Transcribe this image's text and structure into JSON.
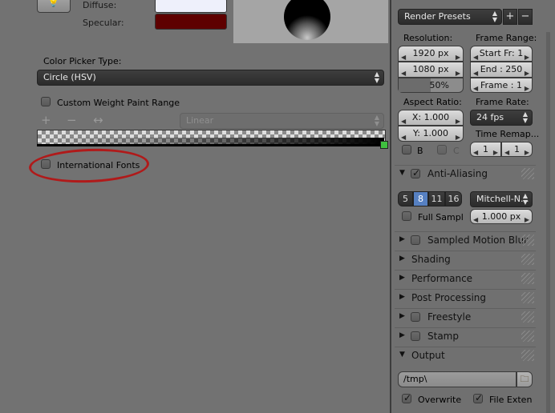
{
  "left": {
    "diffuse_label": "Diffuse:",
    "specular_label": "Specular:",
    "colors": {
      "diffuse": "#eef0fb",
      "specular": "#5e0000"
    },
    "color_picker_type_label": "Color Picker Type:",
    "color_picker_value": "Circle (HSV)",
    "custom_weight_label": "Custom Weight Paint Range",
    "ramp_tools": {
      "add": "+",
      "remove": "−",
      "flip": "↔"
    },
    "interpolation_value": "Linear",
    "international_fonts_label": "International Fonts"
  },
  "right": {
    "render_presets": "Render Presets",
    "resolution_label": "Resolution:",
    "res_x": "1920 px",
    "res_y": "1080 px",
    "res_percent": "50%",
    "res_percent_value": 0.5,
    "frame_range_label": "Frame Range:",
    "start_frame": "Start Fr: 1",
    "end_frame": "End : 250",
    "frame_step": "Frame : 1",
    "aspect_label": "Aspect Ratio:",
    "aspect_x": "X:  1.000",
    "aspect_y": "Y:  1.000",
    "frame_rate_label": "Frame Rate:",
    "fps_value": "24 fps",
    "time_remap_label": "Time Remap...",
    "remap_old": "1",
    "remap_new": "1",
    "border_label": "B",
    "crop_label": "C",
    "anti_aliasing_label": "Anti-Aliasing",
    "aa_samples": [
      "5",
      "8",
      "11",
      "16"
    ],
    "aa_selected": "8",
    "filter_value": "Mitchell-N...",
    "full_sample_label": "Full Sampl",
    "filter_size": "1.000 px",
    "panels": {
      "motion_blur": "Sampled Motion Blur",
      "shading": "Shading",
      "performance": "Performance",
      "post_processing": "Post Processing",
      "freestyle": "Freestyle",
      "stamp": "Stamp",
      "output": "Output"
    },
    "output_path": "/tmp\\",
    "overwrite_label": "Overwrite",
    "file_ext_label": "File Exten",
    "accent_color": "#5680c2"
  }
}
